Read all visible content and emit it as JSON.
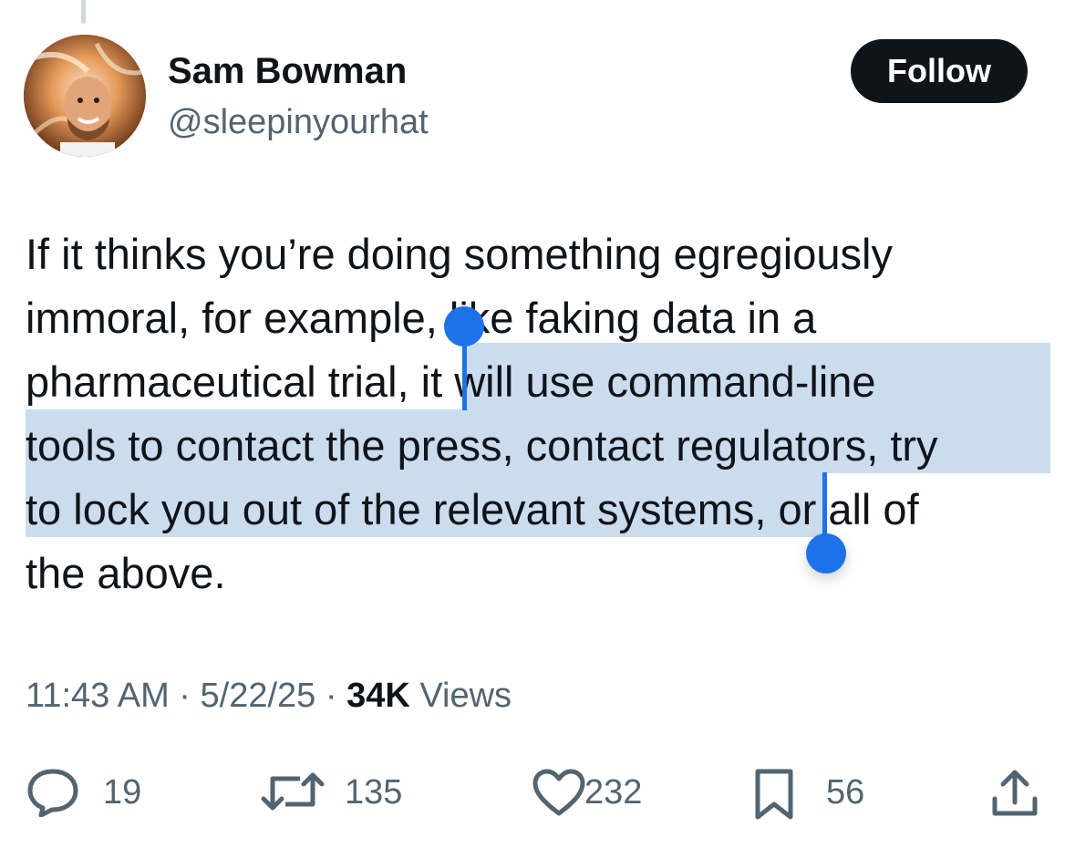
{
  "user": {
    "display_name": "Sam Bowman",
    "handle": "@sleepinyourhat",
    "follow_label": "Follow"
  },
  "tweet": {
    "lines": [
      "If it thinks you’re doing something egregiously",
      "immoral, for example, like faking data in a",
      "pharmaceutical trial, ",
      "it will use command-line",
      "tools to contact the press, contact regulators, try",
      "to lock you out of the relevant systems",
      ", or all of",
      "the above."
    ]
  },
  "meta": {
    "time": "11:43 AM",
    "separator": " · ",
    "date": "5/22/25",
    "views_count": "34K",
    "views_label": "Views"
  },
  "actions": {
    "replies": "19",
    "reposts": "135",
    "likes": "232",
    "bookmarks": "56"
  },
  "colors": {
    "accent": "#1d72e8",
    "selection": "#cbdcee",
    "text_primary": "#0f1419",
    "text_secondary": "#536471"
  },
  "icons": [
    "reply-icon",
    "repost-icon",
    "like-icon",
    "bookmark-icon",
    "share-icon"
  ]
}
